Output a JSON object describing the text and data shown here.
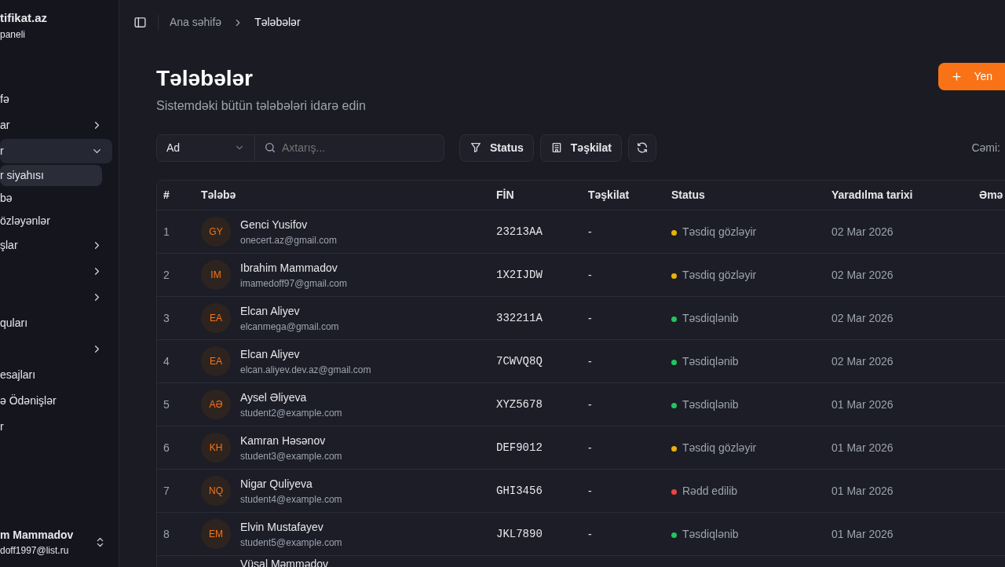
{
  "sidebar": {
    "brand": "tifikat.az",
    "subtitle": "paneli",
    "items": [
      {
        "kind": "link",
        "label": "fə",
        "selected": false
      },
      {
        "kind": "group",
        "label": "ar",
        "expanded": false,
        "selected": false
      },
      {
        "kind": "group",
        "label": "r",
        "expanded": true,
        "selected": true,
        "children": [
          {
            "label": "r siyahısı",
            "selected": true
          },
          {
            "label": "bə",
            "selected": false
          },
          {
            "label": "özləyənlər",
            "selected": false
          }
        ]
      },
      {
        "kind": "group",
        "label": "şlar",
        "expanded": false,
        "selected": false
      },
      {
        "kind": "group",
        "expanded": false,
        "selected": false
      },
      {
        "kind": "group",
        "expanded": false,
        "selected": false
      },
      {
        "kind": "link",
        "label": "quları",
        "selected": false
      },
      {
        "kind": "group",
        "expanded": false,
        "selected": false
      },
      {
        "kind": "link",
        "label": "esajları",
        "selected": false
      },
      {
        "kind": "link",
        "label": "ə Ödənişlər",
        "selected": false
      },
      {
        "kind": "link",
        "label": "r",
        "selected": false
      }
    ],
    "user": {
      "name": "m Mammadov",
      "email": "doff1997@list.ru"
    }
  },
  "breadcrumb": [
    "Ana səhifə",
    "Tələbələr"
  ],
  "page": {
    "title": "Tələbələr",
    "subtitle": "Sistemdəki bütün tələbələri idarə edin",
    "new_button": "Yen"
  },
  "toolbar": {
    "field_select": "Ad",
    "search": {
      "placeholder": "Axtarış..."
    },
    "status_button": "Status",
    "org_button": "Təşkilat",
    "total": "Cəmi:"
  },
  "table": {
    "columns": [
      "#",
      "Tələbə",
      "FİN",
      "Təşkilat",
      "Status",
      "Yaradılma tarixi",
      "Əmə"
    ],
    "rows": [
      {
        "n": "1",
        "initials": "GY",
        "name": "Genci Yusifov",
        "email": "onecert.az@gmail.com",
        "fin": "23213AA",
        "org": "-",
        "status": "Təsdiq gözləyir",
        "color": "#eab308",
        "date": "02 Mar 2026"
      },
      {
        "n": "2",
        "initials": "IM",
        "name": "Ibrahim Mammadov",
        "email": "imamedoff97@gmail.com",
        "fin": "1X2IJDW",
        "org": "-",
        "status": "Təsdiq gözləyir",
        "color": "#eab308",
        "date": "02 Mar 2026"
      },
      {
        "n": "3",
        "initials": "EA",
        "name": "Elcan Aliyev",
        "email": "elcanmega@gmail.com",
        "fin": "332211A",
        "org": "-",
        "status": "Təsdiqlənib",
        "color": "#22c55e",
        "date": "02 Mar 2026"
      },
      {
        "n": "4",
        "initials": "EA",
        "name": "Elcan Aliyev",
        "email": "elcan.aliyev.dev.az@gmail.com",
        "fin": "7CWVQ8Q",
        "org": "-",
        "status": "Təsdiqlənib",
        "color": "#22c55e",
        "date": "02 Mar 2026"
      },
      {
        "n": "5",
        "initials": "AƏ",
        "name": "Aysel Əliyeva",
        "email": "student2@example.com",
        "fin": "XYZ5678",
        "org": "-",
        "status": "Təsdiqlənib",
        "color": "#22c55e",
        "date": "01 Mar 2026"
      },
      {
        "n": "6",
        "initials": "KH",
        "name": "Kamran Həsənov",
        "email": "student3@example.com",
        "fin": "DEF9012",
        "org": "-",
        "status": "Təsdiq gözləyir",
        "color": "#eab308",
        "date": "01 Mar 2026"
      },
      {
        "n": "7",
        "initials": "NQ",
        "name": "Nigar Quliyeva",
        "email": "student4@example.com",
        "fin": "GHI3456",
        "org": "-",
        "status": "Rədd edilib",
        "color": "#ef4444",
        "date": "01 Mar 2026"
      },
      {
        "n": "8",
        "initials": "EM",
        "name": "Elvin Mustafayev",
        "email": "student5@example.com",
        "fin": "JKL7890",
        "org": "-",
        "status": "Təsdiqlənib",
        "color": "#22c55e",
        "date": "01 Mar 2026"
      },
      {
        "name": "Vüsal Məmmədov"
      }
    ]
  }
}
